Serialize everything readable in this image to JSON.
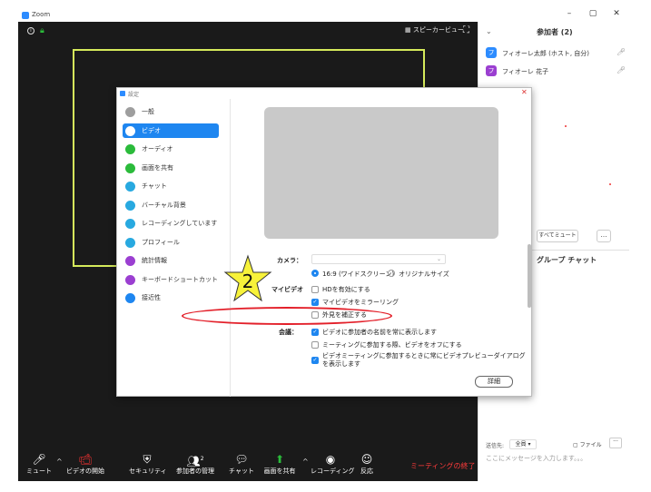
{
  "window": {
    "title": "Zoom",
    "minimize": "–",
    "restore": "▢",
    "close": "✕"
  },
  "meeting": {
    "speaker_view_label": "スピーカービュー"
  },
  "toolbar": {
    "mute": "ミュート",
    "video": "ビデオの開始",
    "security": "セキュリティ",
    "participants": "参加者の管理",
    "participants_count": "2",
    "chat": "チャット",
    "share": "画面を共有",
    "record": "レコーディング",
    "reactions": "反応",
    "end": "ミーティングの終了"
  },
  "participants_panel": {
    "title": "参加者 (2)",
    "items": [
      {
        "name": "フィオーレ太郎 (ホスト, 自分)",
        "avatar": "フ",
        "color": "#2d8cff"
      },
      {
        "name": "フィオーレ 花子",
        "avatar": "フ",
        "color": "#9b3fd1"
      }
    ],
    "mute_all": "すべてミュート",
    "more": "…"
  },
  "chat_panel": {
    "title": "グループ チャット",
    "send_to_label": "送信先:",
    "send_to_value": "全員 ▾",
    "file_label": "ファイル",
    "more": "···",
    "input_placeholder": "ここにメッセージを入力します。。。"
  },
  "settings": {
    "title": "設定",
    "nav": [
      {
        "label": "一般",
        "color": "#9e9e9e",
        "selected": false
      },
      {
        "label": "ビデオ",
        "color": "#1e86f0",
        "selected": true
      },
      {
        "label": "オーディオ",
        "color": "#2bbb3b",
        "selected": false
      },
      {
        "label": "画面を共有",
        "color": "#2bbb3b",
        "selected": false
      },
      {
        "label": "チャット",
        "color": "#28a9e0",
        "selected": false
      },
      {
        "label": "バーチャル背景",
        "color": "#28a9e0",
        "selected": false
      },
      {
        "label": "レコーディングしています",
        "color": "#28a9e0",
        "selected": false
      },
      {
        "label": "プロフィール",
        "color": "#28a9e0",
        "selected": false
      },
      {
        "label": "統計情報",
        "color": "#9b3fd1",
        "selected": false
      },
      {
        "label": "キーボードショートカット",
        "color": "#9b3fd1",
        "selected": false
      },
      {
        "label": "接近性",
        "color": "#1e86f0",
        "selected": false
      }
    ],
    "camera_label": "カメラ：",
    "camera_value": "⌄",
    "aspect_wide": "16:9 (ワイドスクリーン)",
    "aspect_original": "オリジナルサイズ",
    "my_video_label": "マイビデオ",
    "my_video_options": [
      {
        "label": "HDを有効にする",
        "checked": false
      },
      {
        "label": "マイビデオをミラーリング",
        "checked": true
      },
      {
        "label": "外見を補正する",
        "checked": false
      }
    ],
    "meeting_label": "会議：",
    "meeting_options": [
      {
        "label": "ビデオに参加者の名前を常に表示します",
        "checked": true
      },
      {
        "label": "ミーティングに参加する際、ビデオをオフにする",
        "checked": false
      },
      {
        "label": "ビデオミーティングに参加するときに常にビデオプレビューダイアログを表示します",
        "checked": true
      }
    ],
    "detail_button": "詳細"
  },
  "annotation": {
    "step_number": "2",
    "star_color": "#f7f23a"
  }
}
